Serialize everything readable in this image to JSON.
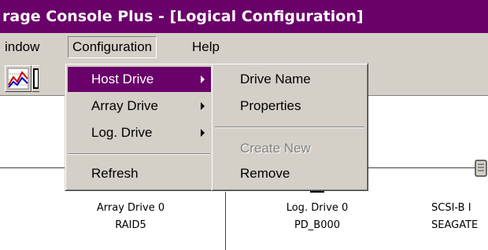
{
  "window": {
    "title": "rage Console Plus - [Logical Configuration]"
  },
  "menubar": {
    "items": [
      {
        "label": "indow"
      },
      {
        "label": "Configuration"
      },
      {
        "label": "Help"
      }
    ]
  },
  "toolbar": {
    "buttons": [
      {
        "icon": "chart-icon"
      },
      {
        "icon": "toolbar-partial-icon"
      }
    ]
  },
  "configuration_menu": {
    "items": [
      {
        "label": "Host Drive",
        "submenu": true
      },
      {
        "label": "Array Drive",
        "submenu": true
      },
      {
        "label": "Log. Drive",
        "submenu": true
      },
      {
        "label": "Refresh",
        "submenu": false
      }
    ]
  },
  "host_drive_submenu": {
    "items": [
      {
        "label": "Drive Name",
        "enabled": true
      },
      {
        "label": "Properties",
        "enabled": true
      },
      {
        "label": "Create New",
        "enabled": false
      },
      {
        "label": "Remove",
        "enabled": true
      }
    ]
  },
  "devices": [
    {
      "name": "Array Drive 0",
      "detail": "RAID5"
    },
    {
      "name": "Log. Drive 0",
      "detail": "PD_B000"
    },
    {
      "name": "SCSI-B I",
      "detail": "SEAGATE"
    }
  ],
  "colors": {
    "title_bg": "#6a006a",
    "highlight": "#6a006a",
    "face": "#d4d0c8"
  }
}
